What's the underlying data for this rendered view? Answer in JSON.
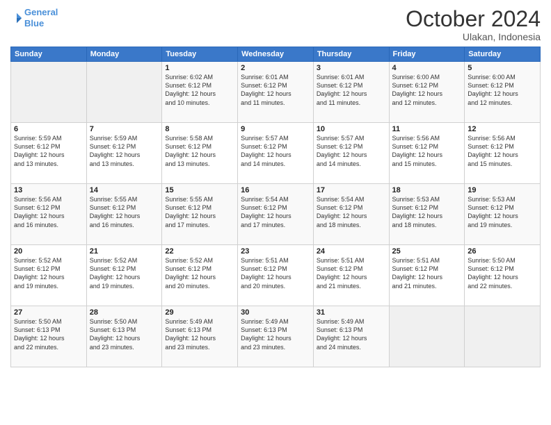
{
  "header": {
    "logo_line1": "General",
    "logo_line2": "Blue",
    "month": "October 2024",
    "location": "Ulakan, Indonesia"
  },
  "weekdays": [
    "Sunday",
    "Monday",
    "Tuesday",
    "Wednesday",
    "Thursday",
    "Friday",
    "Saturday"
  ],
  "weeks": [
    [
      {
        "day": "",
        "info": ""
      },
      {
        "day": "",
        "info": ""
      },
      {
        "day": "1",
        "info": "Sunrise: 6:02 AM\nSunset: 6:12 PM\nDaylight: 12 hours\nand 10 minutes."
      },
      {
        "day": "2",
        "info": "Sunrise: 6:01 AM\nSunset: 6:12 PM\nDaylight: 12 hours\nand 11 minutes."
      },
      {
        "day": "3",
        "info": "Sunrise: 6:01 AM\nSunset: 6:12 PM\nDaylight: 12 hours\nand 11 minutes."
      },
      {
        "day": "4",
        "info": "Sunrise: 6:00 AM\nSunset: 6:12 PM\nDaylight: 12 hours\nand 12 minutes."
      },
      {
        "day": "5",
        "info": "Sunrise: 6:00 AM\nSunset: 6:12 PM\nDaylight: 12 hours\nand 12 minutes."
      }
    ],
    [
      {
        "day": "6",
        "info": "Sunrise: 5:59 AM\nSunset: 6:12 PM\nDaylight: 12 hours\nand 13 minutes."
      },
      {
        "day": "7",
        "info": "Sunrise: 5:59 AM\nSunset: 6:12 PM\nDaylight: 12 hours\nand 13 minutes."
      },
      {
        "day": "8",
        "info": "Sunrise: 5:58 AM\nSunset: 6:12 PM\nDaylight: 12 hours\nand 13 minutes."
      },
      {
        "day": "9",
        "info": "Sunrise: 5:57 AM\nSunset: 6:12 PM\nDaylight: 12 hours\nand 14 minutes."
      },
      {
        "day": "10",
        "info": "Sunrise: 5:57 AM\nSunset: 6:12 PM\nDaylight: 12 hours\nand 14 minutes."
      },
      {
        "day": "11",
        "info": "Sunrise: 5:56 AM\nSunset: 6:12 PM\nDaylight: 12 hours\nand 15 minutes."
      },
      {
        "day": "12",
        "info": "Sunrise: 5:56 AM\nSunset: 6:12 PM\nDaylight: 12 hours\nand 15 minutes."
      }
    ],
    [
      {
        "day": "13",
        "info": "Sunrise: 5:56 AM\nSunset: 6:12 PM\nDaylight: 12 hours\nand 16 minutes."
      },
      {
        "day": "14",
        "info": "Sunrise: 5:55 AM\nSunset: 6:12 PM\nDaylight: 12 hours\nand 16 minutes."
      },
      {
        "day": "15",
        "info": "Sunrise: 5:55 AM\nSunset: 6:12 PM\nDaylight: 12 hours\nand 17 minutes."
      },
      {
        "day": "16",
        "info": "Sunrise: 5:54 AM\nSunset: 6:12 PM\nDaylight: 12 hours\nand 17 minutes."
      },
      {
        "day": "17",
        "info": "Sunrise: 5:54 AM\nSunset: 6:12 PM\nDaylight: 12 hours\nand 18 minutes."
      },
      {
        "day": "18",
        "info": "Sunrise: 5:53 AM\nSunset: 6:12 PM\nDaylight: 12 hours\nand 18 minutes."
      },
      {
        "day": "19",
        "info": "Sunrise: 5:53 AM\nSunset: 6:12 PM\nDaylight: 12 hours\nand 19 minutes."
      }
    ],
    [
      {
        "day": "20",
        "info": "Sunrise: 5:52 AM\nSunset: 6:12 PM\nDaylight: 12 hours\nand 19 minutes."
      },
      {
        "day": "21",
        "info": "Sunrise: 5:52 AM\nSunset: 6:12 PM\nDaylight: 12 hours\nand 19 minutes."
      },
      {
        "day": "22",
        "info": "Sunrise: 5:52 AM\nSunset: 6:12 PM\nDaylight: 12 hours\nand 20 minutes."
      },
      {
        "day": "23",
        "info": "Sunrise: 5:51 AM\nSunset: 6:12 PM\nDaylight: 12 hours\nand 20 minutes."
      },
      {
        "day": "24",
        "info": "Sunrise: 5:51 AM\nSunset: 6:12 PM\nDaylight: 12 hours\nand 21 minutes."
      },
      {
        "day": "25",
        "info": "Sunrise: 5:51 AM\nSunset: 6:12 PM\nDaylight: 12 hours\nand 21 minutes."
      },
      {
        "day": "26",
        "info": "Sunrise: 5:50 AM\nSunset: 6:12 PM\nDaylight: 12 hours\nand 22 minutes."
      }
    ],
    [
      {
        "day": "27",
        "info": "Sunrise: 5:50 AM\nSunset: 6:13 PM\nDaylight: 12 hours\nand 22 minutes."
      },
      {
        "day": "28",
        "info": "Sunrise: 5:50 AM\nSunset: 6:13 PM\nDaylight: 12 hours\nand 23 minutes."
      },
      {
        "day": "29",
        "info": "Sunrise: 5:49 AM\nSunset: 6:13 PM\nDaylight: 12 hours\nand 23 minutes."
      },
      {
        "day": "30",
        "info": "Sunrise: 5:49 AM\nSunset: 6:13 PM\nDaylight: 12 hours\nand 23 minutes."
      },
      {
        "day": "31",
        "info": "Sunrise: 5:49 AM\nSunset: 6:13 PM\nDaylight: 12 hours\nand 24 minutes."
      },
      {
        "day": "",
        "info": ""
      },
      {
        "day": "",
        "info": ""
      }
    ]
  ]
}
